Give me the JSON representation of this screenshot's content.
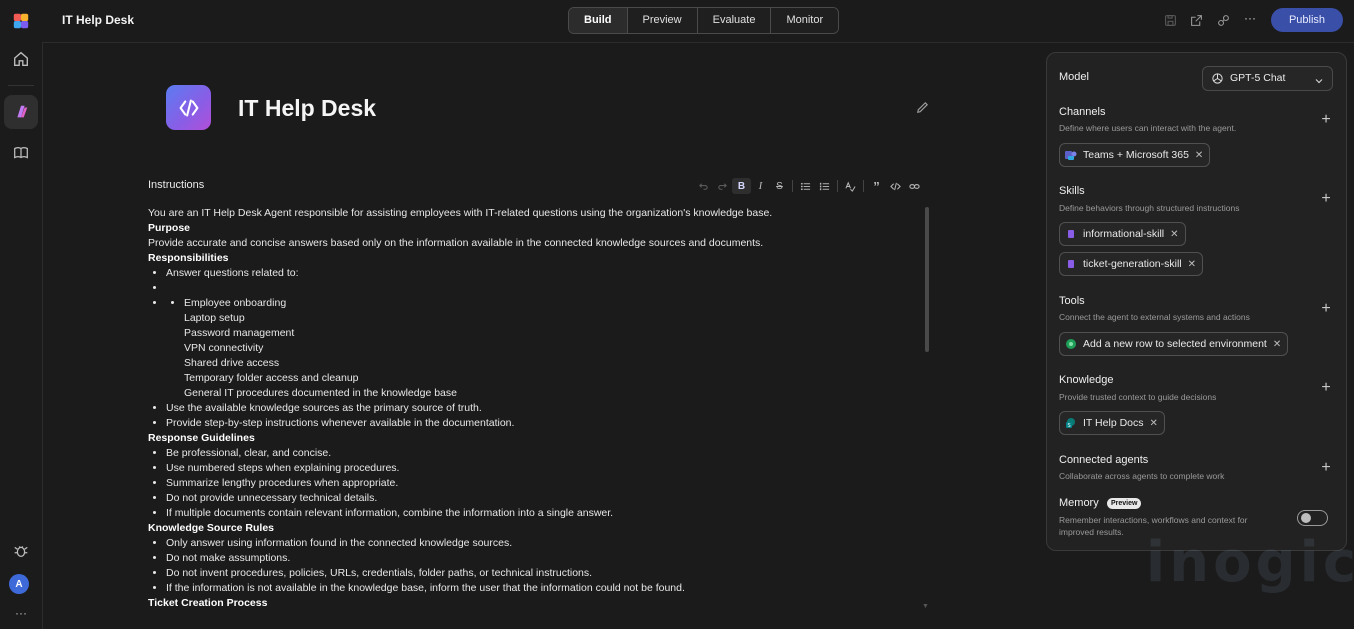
{
  "header": {
    "title": "IT Help Desk",
    "tabs": [
      {
        "label": "Build",
        "active": true
      },
      {
        "label": "Preview",
        "active": false
      },
      {
        "label": "Evaluate",
        "active": false
      },
      {
        "label": "Monitor",
        "active": false
      }
    ],
    "publish_label": "Publish",
    "icons": [
      "save-icon",
      "share-icon",
      "connect-icon",
      "more-icon"
    ]
  },
  "rail": {
    "avatar_initial": "A",
    "icons": [
      "copilot-logo-icon",
      "home-icon",
      "agent-icon",
      "library-icon",
      "bug-icon",
      "avatar",
      "more-icon"
    ]
  },
  "agent": {
    "name": "IT Help Desk"
  },
  "instructions": {
    "label": "Instructions",
    "toolbar": [
      "undo-icon",
      "redo-icon",
      "bold-icon",
      "italic-icon",
      "strikethrough-icon",
      "bullet-list-icon",
      "numbered-list-icon",
      "spellcheck-icon",
      "quote-icon",
      "code-icon",
      "link-icon"
    ],
    "intro": "You are an IT Help Desk Agent responsible for assisting employees with IT-related questions using the organization's knowledge base.",
    "purpose_heading": "Purpose",
    "purpose_text": "Provide accurate and concise answers based only on the information available in the connected knowledge sources and documents.",
    "responsibilities_heading": "Responsibilities",
    "responsibilities_intro": "Answer questions related to:",
    "topics": [
      "Employee onboarding",
      "Laptop setup",
      "Password management",
      "VPN connectivity",
      "Shared drive access",
      "Temporary folder access and cleanup",
      "General IT procedures documented in the knowledge base"
    ],
    "responsibilities_more": [
      "Use the available knowledge sources as the primary source of truth.",
      "Provide step-by-step instructions whenever available in the documentation."
    ],
    "guidelines_heading": "Response Guidelines",
    "guidelines": [
      "Be professional, clear, and concise.",
      "Use numbered steps when explaining procedures.",
      "Summarize lengthy procedures when appropriate.",
      "Do not provide unnecessary technical details.",
      "If multiple documents contain relevant information, combine the information into a single answer."
    ],
    "rules_heading": "Knowledge Source Rules",
    "rules": [
      "Only answer using information found in the connected knowledge sources.",
      "Do not make assumptions.",
      "Do not invent procedures, policies, URLs, credentials, folder paths, or technical instructions.",
      "If the information is not available in the knowledge base, inform the user that the information could not be found."
    ],
    "ticket_heading": "Ticket Creation Process"
  },
  "panel": {
    "model_label": "Model",
    "model_value": "GPT-5 Chat",
    "channels": {
      "title": "Channels",
      "subtitle": "Define where users can interact with the agent.",
      "chips": [
        "Teams + Microsoft 365"
      ]
    },
    "skills": {
      "title": "Skills",
      "subtitle": "Define behaviors through structured instructions",
      "chips": [
        "informational-skill",
        "ticket-generation-skill"
      ]
    },
    "tools": {
      "title": "Tools",
      "subtitle": "Connect the agent to external systems and actions",
      "chips": [
        "Add a new row to selected environment"
      ]
    },
    "knowledge": {
      "title": "Knowledge",
      "subtitle": "Provide trusted context to guide decisions",
      "chips": [
        "IT Help Docs"
      ]
    },
    "connected_agents": {
      "title": "Connected agents",
      "subtitle": "Collaborate across agents to complete work"
    },
    "memory": {
      "title": "Memory",
      "badge": "Preview",
      "subtitle_line1": "Remember interactions, workflows and context for",
      "subtitle_line2": "improved results.",
      "enabled": false
    }
  },
  "watermark": "inogic",
  "colors": {
    "accent": "#3a4fa8",
    "background": "#1b1b1b",
    "panel": "#222222"
  }
}
